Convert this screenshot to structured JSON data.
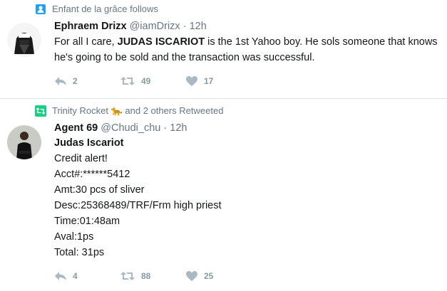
{
  "tweets": [
    {
      "context": "Enfant de la grâce follows",
      "name": "Ephraem Drizx",
      "handle": "@iamDrizx",
      "time": "12h",
      "text_pre": "For all I care, ",
      "text_bold": "JUDAS ISCARIOT",
      "text_post": " is the 1st Yahoo boy. He sols someone that knows he's going to be sold and the transaction was successful.",
      "replies": "2",
      "retweets": "49",
      "likes": "17"
    },
    {
      "context": "Trinity Rocket 🐆 and 2 others Retweeted",
      "name": "Agent 69",
      "handle": "@Chudi_chu",
      "time": "12h",
      "lines": [
        "Judas Iscariot",
        "Credit alert!",
        "Acct#:******5412",
        "Amt:30 pcs of sliver",
        "Desc:25368489/TRF/Frm high priest",
        "Time:01:48am",
        "Aval:1ps",
        "Total: 31ps"
      ],
      "replies": "4",
      "retweets": "88",
      "likes": "25"
    }
  ],
  "colors": {
    "follow_icon": "#1da1f2",
    "retweet_icon": "#19cf86",
    "muted": "#657786",
    "action": "#8899a6"
  }
}
